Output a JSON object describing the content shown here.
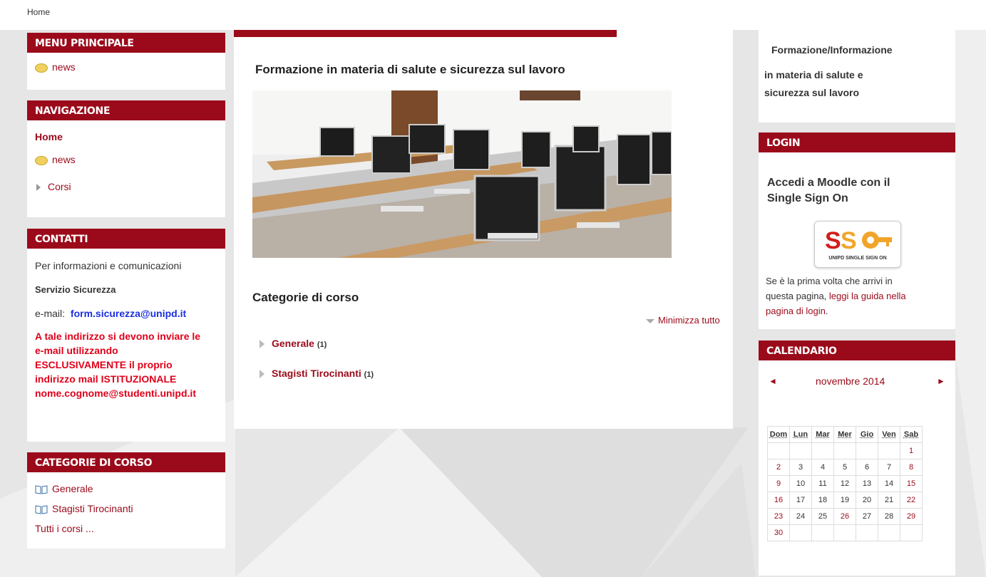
{
  "breadcrumb": "Home",
  "menu_principale": {
    "title": "MENU PRINCIPALE",
    "items": [
      {
        "label": "news",
        "icon": "speech-bubble-icon"
      }
    ]
  },
  "navigazione": {
    "title": "NAVIGAZIONE",
    "home": "Home",
    "news": "news",
    "corsi": "Corsi"
  },
  "contatti": {
    "title": "CONTATTI",
    "line1": "Per informazioni e comunicazioni",
    "servizio": "Servizio Sicurezza",
    "email_label": "e-mail:",
    "email": "form.sicurezza@unipd.it",
    "warning_lines": [
      "A tale indirizzo si devono inviare le",
      "e-mail utilizzando",
      "ESCLUSIVAMENTE il proprio",
      "indirizzo mail ISTITUZIONALE",
      "nome.cognome@studenti.unipd.it"
    ]
  },
  "categorie_block": {
    "title": "CATEGORIE DI CORSO",
    "items": [
      "Generale",
      "Stagisti Tirocinanti"
    ],
    "all": "Tutti i corsi ..."
  },
  "main": {
    "heading": "Formazione in materia di salute e sicurezza sul lavoro",
    "categories_title": "Categorie di corso",
    "collapse_label": "Minimizza tutto",
    "categories": [
      {
        "name": "Generale",
        "count": "(1)"
      },
      {
        "name": "Stagisti Tirocinanti",
        "count": "(1)"
      }
    ]
  },
  "right_info": {
    "line1": "Formazione/Informazione",
    "line2": "in materia  di salute e",
    "line3": "sicurezza sul lavoro"
  },
  "login": {
    "title": "LOGIN",
    "heading_line1": "Accedi a Moodle con il",
    "heading_line2": "Single Sign On",
    "sso_logo_text": "UNIPD SINGLE SIGN ON",
    "text_part1": "Se è la prima volta che arrivi in",
    "text_part2": "questa pagina, ",
    "text_link1": "leggi la guida nella",
    "text_link2": "pagina di login",
    "text_end": "."
  },
  "calendar": {
    "title": "CALENDARIO",
    "month": "novembre 2014",
    "prev": "◄",
    "next": "►",
    "days": [
      "Dom",
      "Lun",
      "Mar",
      "Mer",
      "Gio",
      "Ven",
      "Sab"
    ],
    "weeks": [
      [
        "",
        "",
        "",
        "",
        "",
        "",
        "1"
      ],
      [
        "2",
        "3",
        "4",
        "5",
        "6",
        "7",
        "8"
      ],
      [
        "9",
        "10",
        "11",
        "12",
        "13",
        "14",
        "15"
      ],
      [
        "16",
        "17",
        "18",
        "19",
        "20",
        "21",
        "22"
      ],
      [
        "23",
        "24",
        "25",
        "26",
        "27",
        "28",
        "29"
      ],
      [
        "30",
        "",
        "",
        "",
        "",
        "",
        ""
      ]
    ],
    "highlight_day": "26"
  },
  "colors": {
    "brand": "#9b0a1a",
    "email": "#1a2ee0",
    "warning": "#e0001a"
  }
}
